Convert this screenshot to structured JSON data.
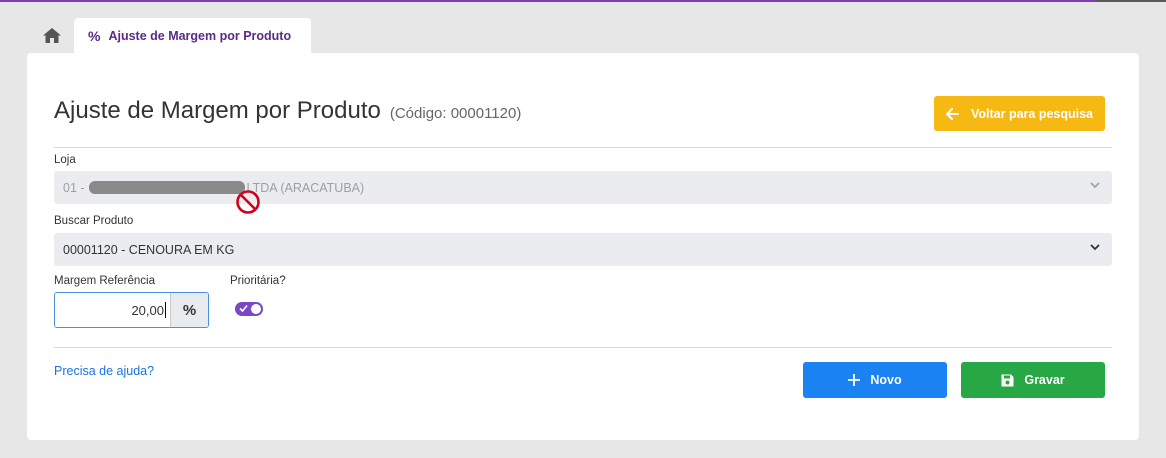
{
  "tabs": {
    "home_icon": "home-icon",
    "active": {
      "icon": "percent-icon",
      "icon_text": "%",
      "label": "Ajuste de Margem por Produto"
    }
  },
  "header": {
    "title": "Ajuste de Margem por Produto",
    "code": "(Código: 00001120)",
    "back_button": "Voltar para pesquisa"
  },
  "form": {
    "loja": {
      "label": "Loja",
      "prefix": "01 -",
      "suffix": "LTDA (ARACATUBA)",
      "disabled": true
    },
    "produto": {
      "label": "Buscar Produto",
      "value": "00001120 - CENOURA EM KG"
    },
    "margem": {
      "label": "Margem Referência",
      "value": "20,00",
      "addon": "%"
    },
    "prioritaria": {
      "label": "Prioritária?",
      "checked": true
    }
  },
  "footer": {
    "help": "Precisa de ajuda?",
    "new_button": "Novo",
    "save_button": "Gravar"
  },
  "colors": {
    "accent": "#5b2a86",
    "warning": "#f6b913",
    "primary": "#1b82f1",
    "success": "#28a745",
    "toggle": "#7a48c4"
  }
}
